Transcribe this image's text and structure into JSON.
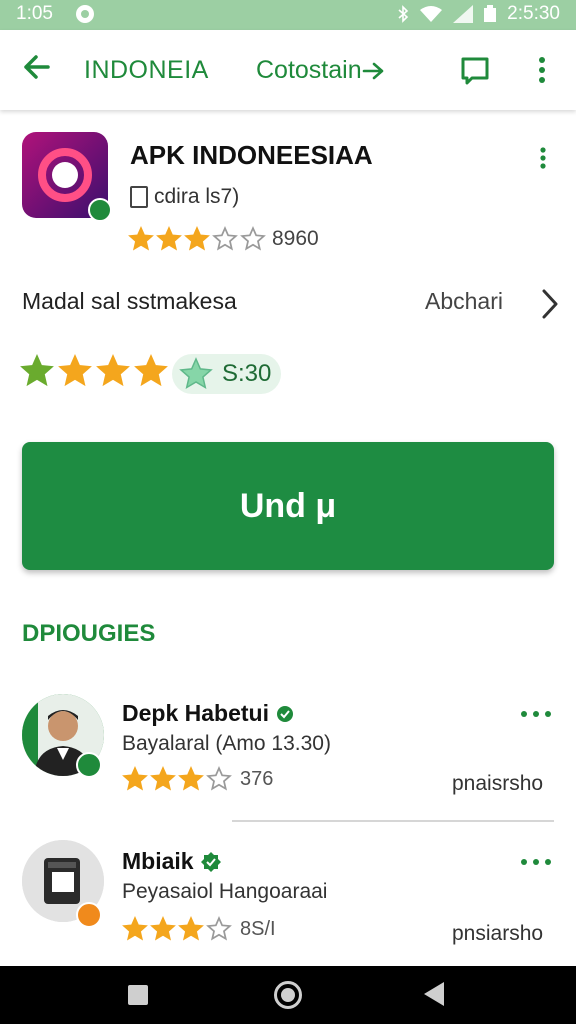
{
  "status_bar": {
    "time_left": "1:05",
    "time_right": "2:5:30"
  },
  "app_bar": {
    "title": "INDONEIA",
    "secondary": "Cotostain"
  },
  "app": {
    "title": "APK INDONEESIAA",
    "meta": "cdira ls7)",
    "rating_stars": 3,
    "rating_text": "8960"
  },
  "info_row": {
    "label": "Madal sal sstmakesa",
    "action": "Abchari"
  },
  "rating_row": {
    "stars": 4,
    "pill_text": "S:30"
  },
  "install_button": {
    "label": "Und μ"
  },
  "section_title": "DPIOUGIES",
  "reviews": [
    {
      "name": "Depk Habetui",
      "subtitle": "Bayalaral (Amo 13.30)",
      "stars": 3,
      "score": "376",
      "tag": "pnaisrsho"
    },
    {
      "name": "Mbiaik",
      "subtitle": "Peyasaiol Hangoaraai",
      "stars": 3,
      "score": "8S/I",
      "tag": "pnsiarsho"
    }
  ],
  "colors": {
    "accent": "#1f8a3b",
    "install": "#1e8c42",
    "star": "#f4a61d"
  }
}
